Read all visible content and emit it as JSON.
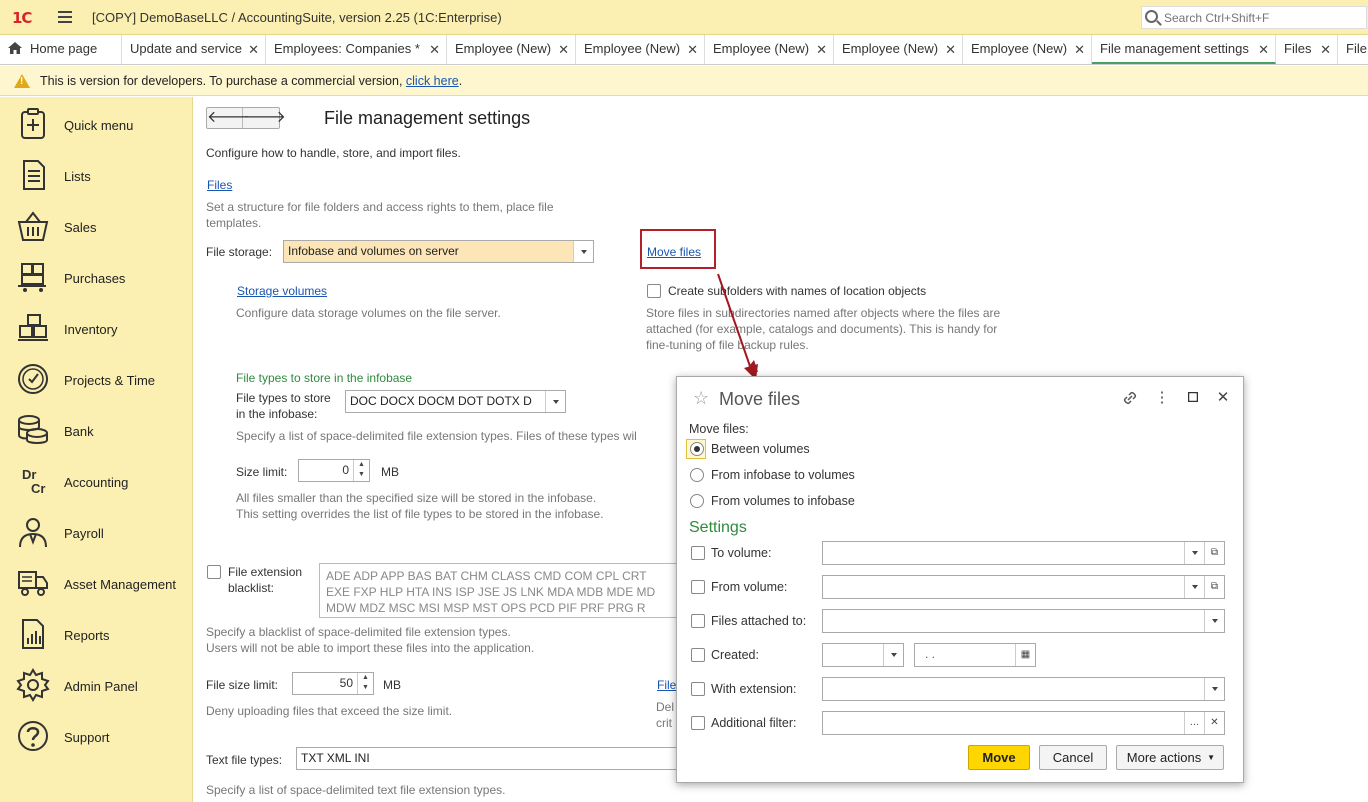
{
  "app": {
    "logo": "1C",
    "title": "[COPY] DemoBaseLLC / AccountingSuite, version 2.25  (1C:Enterprise)",
    "search_placeholder": "Search Ctrl+Shift+F"
  },
  "tabs": [
    {
      "label": "Home page"
    },
    {
      "label": "Update and service"
    },
    {
      "label": "Employees: Companies *"
    },
    {
      "label": "Employee (New)"
    },
    {
      "label": "Employee (New)"
    },
    {
      "label": "Employee (New)"
    },
    {
      "label": "Employee (New)"
    },
    {
      "label": "Employee (New)"
    },
    {
      "label": "File management settings"
    },
    {
      "label": "Files"
    },
    {
      "label": "File"
    }
  ],
  "banner": {
    "text": "This is version for developers. To purchase a commercial version, ",
    "link": "click here",
    "suffix": "."
  },
  "sidebar": {
    "items": [
      {
        "label": "Quick menu",
        "icon": "quick-menu-icon"
      },
      {
        "label": "Lists",
        "icon": "lists-icon"
      },
      {
        "label": "Sales",
        "icon": "basket-icon"
      },
      {
        "label": "Purchases",
        "icon": "cart-icon"
      },
      {
        "label": "Inventory",
        "icon": "boxes-icon"
      },
      {
        "label": "Projects & Time",
        "icon": "clock-icon"
      },
      {
        "label": "Bank",
        "icon": "coins-icon"
      },
      {
        "label": "Accounting",
        "icon": "dr-cr-icon"
      },
      {
        "label": "Payroll",
        "icon": "person-icon"
      },
      {
        "label": "Asset Management",
        "icon": "truck-icon"
      },
      {
        "label": "Reports",
        "icon": "report-icon"
      },
      {
        "label": "Admin Panel",
        "icon": "gear-icon"
      },
      {
        "label": "Support",
        "icon": "question-icon"
      }
    ],
    "dr": "Dr",
    "cr": "Cr"
  },
  "main": {
    "title": "File management settings",
    "description": "Configure how to handle, store, and import files.",
    "files_link": "Files",
    "files_desc_1": "Set a structure for file folders and access rights to them, place file",
    "files_desc_2": "templates.",
    "file_storage_label": "File storage:",
    "file_storage_value": "Infobase and volumes on server",
    "move_files_link": "Move files",
    "storage_volumes_link": "Storage volumes",
    "storage_volumes_desc": "Configure data storage volumes on the file server.",
    "create_subfolders_label": "Create subfolders with names of location objects",
    "subfolders_desc_1": "Store files in subdirectories named after objects where the files are",
    "subfolders_desc_2": "attached (for example, catalogs and documents). This is handy for",
    "subfolders_desc_3": "fine-tuning of file backup rules.",
    "file_types_header": "File types to store in the infobase",
    "file_types_label_1": "File types to store",
    "file_types_label_2": "in the infobase:",
    "file_types_value": "DOC DOCX DOCM DOT DOTX D",
    "file_types_desc": "Specify a list of space-delimited file extension types. Files of these types wil",
    "size_limit_label": "Size limit:",
    "size_limit_value": "0",
    "size_limit_unit": "MB",
    "size_limit_desc_1": "All files smaller than the specified size will be stored in the infobase.",
    "size_limit_desc_2": "This setting overrides the list of file types to be stored in the infobase.",
    "blacklist_label_1": "File extension",
    "blacklist_label_2": "blacklist:",
    "blacklist_line_1": "ADE ADP APP BAS BAT CHM CLASS CMD COM CPL CRT",
    "blacklist_line_2": "EXE FXP HLP HTA INS ISP JSE JS LNK MDA MDB MDE MD",
    "blacklist_line_3": "MDW MDZ MSC MSI MSP MST OPS PCD PIF PRF PRG R",
    "blacklist_desc_1": "Specify a blacklist of space-delimited file extension types.",
    "blacklist_desc_2": "Users will not be able to import these files into the application.",
    "file_size_limit_label": "File size limit:",
    "file_size_limit_value": "50",
    "file_size_limit_unit": "MB",
    "file_size_limit_desc": "Deny uploading files that exceed the size limit.",
    "file_link_partial": "File",
    "partial_desc_1": "Del",
    "partial_desc_2": "crit",
    "text_file_types_label": "Text file types:",
    "text_file_types_value": "TXT XML INI",
    "text_file_types_desc": "Specify a list of space-delimited text file extension types."
  },
  "dialog": {
    "title": "Move files",
    "move_files_label": "Move files:",
    "options": [
      {
        "label": "Between volumes",
        "selected": true
      },
      {
        "label": "From infobase to volumes",
        "selected": false
      },
      {
        "label": "From volumes to infobase",
        "selected": false
      }
    ],
    "settings_header": "Settings",
    "fields": [
      {
        "label": "To volume:"
      },
      {
        "label": "From volume:"
      },
      {
        "label": "Files attached to:"
      },
      {
        "label": "Created:"
      },
      {
        "label": "With extension:"
      },
      {
        "label": "Additional filter:"
      }
    ],
    "created_date_placeholder": " .  .",
    "move_button": "Move",
    "cancel_button": "Cancel",
    "more_actions_button": "More actions"
  },
  "colors": {
    "sidebar_bg": "#fbf0b2",
    "accent_link": "#1a55b0",
    "highlight_border": "#b3202a",
    "primary_button": "#ffd600",
    "green_header": "#2e8b3e"
  }
}
